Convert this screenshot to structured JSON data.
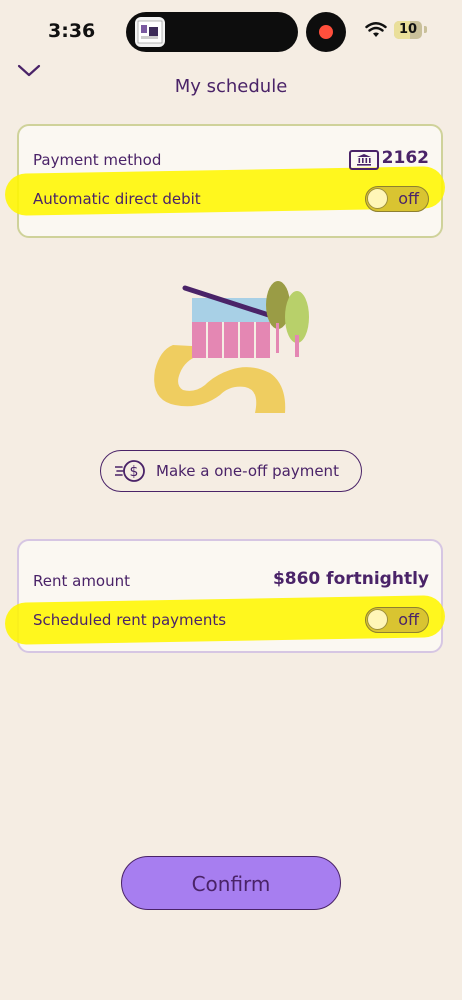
{
  "status_bar": {
    "time": "3:36",
    "battery_level": "10",
    "icons": [
      "wifi-icon",
      "battery-icon",
      "screen-recording-icon"
    ]
  },
  "header": {
    "title": "My schedule",
    "back_icon": "chevron-down-icon"
  },
  "payment_card": {
    "method_label": "Payment method",
    "account_icon": "bank-icon",
    "account_number": "2162",
    "debit_label": "Automatic direct debit",
    "debit_toggle": "off"
  },
  "illustration": {
    "icon": "house-on-path-illustration"
  },
  "oneoff": {
    "label": "Make a one-off payment",
    "icon": "dollar-coin-motion-icon"
  },
  "rent_card": {
    "amount_label": "Rent amount",
    "amount_value": "$860 fortnightly",
    "schedule_label": "Scheduled rent payments",
    "schedule_toggle": "off"
  },
  "confirm": {
    "label": "Confirm"
  },
  "colors": {
    "background": "#f5ede3",
    "primary_text": "#4a2368",
    "confirm_button": "#a77ef0",
    "toggle_off": "#d9c431",
    "highlight": "#fff600"
  }
}
